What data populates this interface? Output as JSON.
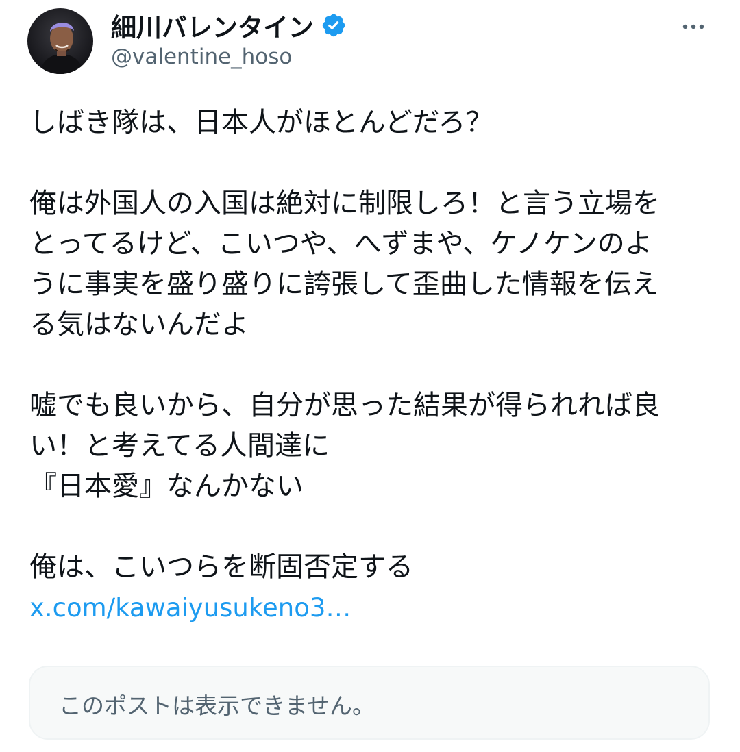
{
  "author": {
    "display_name": "細川バレンタイン",
    "handle": "@valentine_hoso",
    "verified": true,
    "avatar_icon": "profile-photo"
  },
  "more_icon": "more-options-icon",
  "tweet": {
    "lines": [
      "しばき隊は、日本人がほとんどだろ？",
      "",
      "俺は外国人の入国は絶対に制限しろ！と言う立場を",
      "とってるけど、こいつや、へずまや、ケノケンのよ",
      "うに事実を盛り盛りに誇張して歪曲した情報を伝え",
      "る気はないんだよ",
      "",
      "嘘でも良いから、自分が思った結果が得られれば良",
      "い！と考えてる人間達に",
      "『日本愛』なんかない",
      "",
      "俺は、こいつらを断固否定する"
    ],
    "link_text": "x.com/kawaiyusukeno3…"
  },
  "quoted_post": {
    "message": "このポストは表示できません。"
  },
  "colors": {
    "text": "#0f1419",
    "secondary": "#536471",
    "link": "#1d9bf0",
    "verified": "#1d9bf0",
    "quote_bg": "#f7f9f9",
    "quote_border": "#eff3f4"
  }
}
